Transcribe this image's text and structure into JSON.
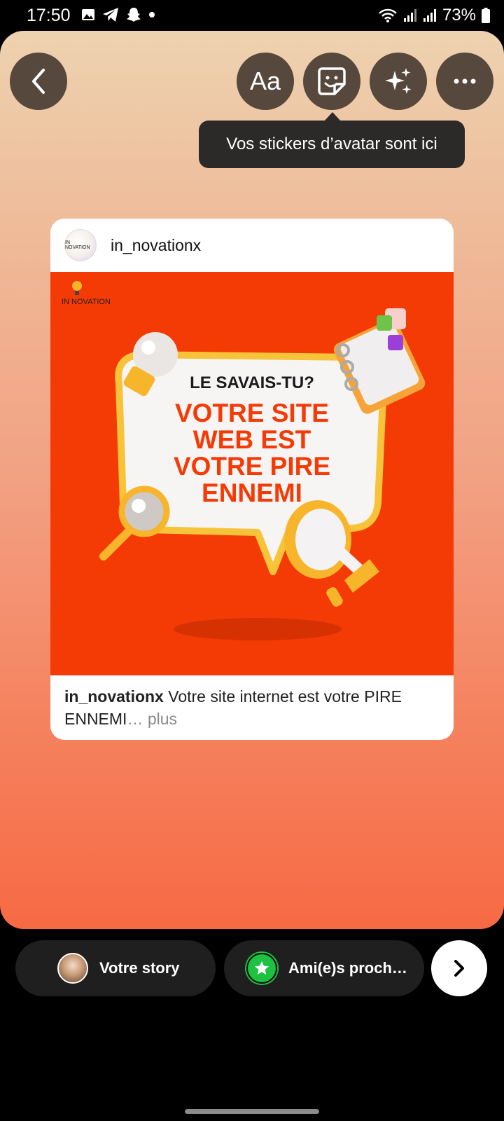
{
  "status_bar": {
    "time": "17:50",
    "battery": "73%",
    "icons": [
      "gallery-icon",
      "telegram-icon",
      "snapchat-icon",
      "dot-icon",
      "wifi-icon",
      "signal-icon",
      "signal-icon",
      "battery-icon"
    ]
  },
  "toolbar": {
    "text_label": "Aa",
    "tooltip": "Vos stickers d’avatar sont ici"
  },
  "post": {
    "avatar_text": "IN NOVATION",
    "username": "in_novationx",
    "image": {
      "brand": "IN NOVATION",
      "headline_small": "LE SAVAIS-TU?",
      "headline_lines": [
        "VOTRE SITE",
        "WEB EST",
        "VOTRE PIRE",
        "ENNEMI"
      ]
    },
    "caption_user": "in_novationx",
    "caption_text": " Votre site internet est votre PIRE ENNEMI",
    "caption_more": "… plus"
  },
  "bottom": {
    "your_story": "Votre story",
    "close_friends": "Ami(e)s proch…"
  },
  "colors": {
    "post_bg": "#f43a05",
    "accent_yellow": "#f6b52a",
    "close_friends_green": "#1fc142"
  }
}
